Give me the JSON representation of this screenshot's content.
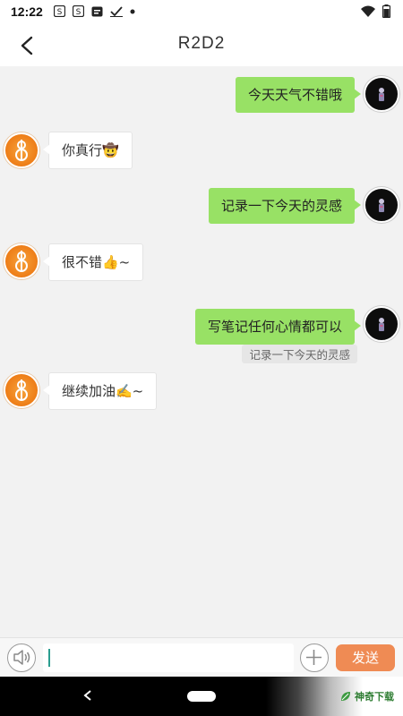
{
  "status_bar": {
    "time": "12:22",
    "icons_left": [
      "s-badge-icon",
      "s-badge-icon",
      "message-icon",
      "check-icon",
      "dot-icon"
    ],
    "icons_right": [
      "wifi-icon",
      "battery-icon"
    ]
  },
  "header": {
    "title": "R2D2",
    "back_icon": "chevron-left-icon"
  },
  "messages": [
    {
      "side": "right",
      "text": "今天天气不错哦",
      "avatar": "robot-avatar"
    },
    {
      "side": "left",
      "text": "你真行🤠",
      "avatar": "bot-avatar"
    },
    {
      "side": "right",
      "text": "记录一下今天的灵感",
      "avatar": "robot-avatar"
    },
    {
      "side": "left",
      "text": "很不错👍~",
      "avatar": "bot-avatar"
    },
    {
      "side": "right",
      "text": "写笔记任何心情都可以",
      "avatar": "robot-avatar",
      "tag": "记录一下今天的灵感"
    },
    {
      "side": "left",
      "text": "继续加油✍️~",
      "avatar": "bot-avatar"
    }
  ],
  "input_bar": {
    "value": "",
    "send_label": "发送"
  },
  "watermark": {
    "text": "神奇下载"
  },
  "colors": {
    "my_bubble": "#98e165",
    "bot_bubble": "#ffffff",
    "send_button": "#ef8b54",
    "background": "#f2f2f2"
  }
}
